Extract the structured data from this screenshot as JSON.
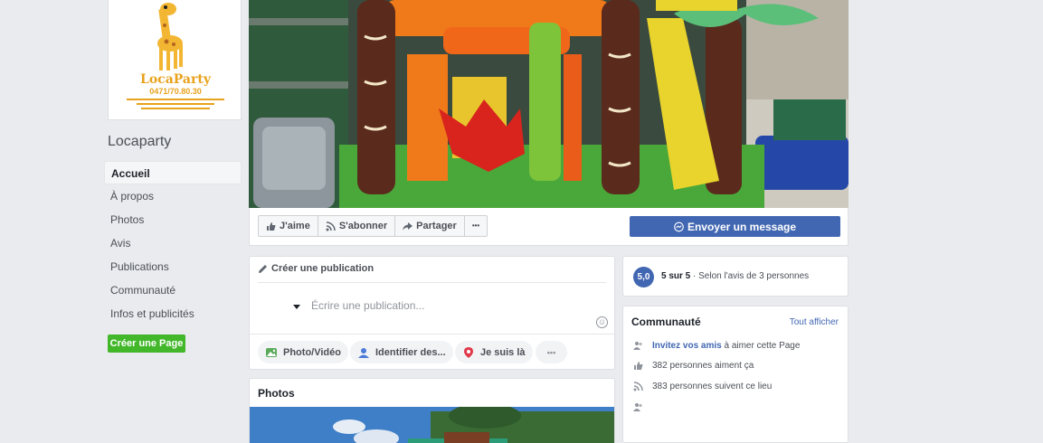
{
  "page": {
    "name": "Locaparty",
    "logo_text": "LocaParty",
    "logo_phone": "0471/70.80.30"
  },
  "nav": {
    "items": [
      {
        "label": "Accueil"
      },
      {
        "label": "À propos"
      },
      {
        "label": "Photos"
      },
      {
        "label": "Avis"
      },
      {
        "label": "Publications"
      },
      {
        "label": "Communauté"
      },
      {
        "label": "Infos et publicités"
      }
    ],
    "create_page": "Créer une Page"
  },
  "actions": {
    "like": "J'aime",
    "follow": "S'abonner",
    "share": "Partager",
    "more": "•••",
    "message": "Envoyer un message"
  },
  "post": {
    "header": "Créer une publication",
    "placeholder": "Écrire une publication...",
    "buttons": [
      {
        "label": "Photo/Vidéo"
      },
      {
        "label": "Identifier des..."
      },
      {
        "label": "Je suis là"
      },
      {
        "label": "•••"
      }
    ]
  },
  "photos": {
    "title": "Photos"
  },
  "rating": {
    "score": "5,0",
    "score_text": "5 sur 5",
    "description": " · Selon l'avis de 3 personnes"
  },
  "community": {
    "title": "Communauté",
    "see_all": "Tout afficher",
    "invite_link": "Invitez vos amis",
    "invite_rest": " à aimer cette Page",
    "likes": "382 personnes aiment ça",
    "follows": "383 personnes suivent ce lieu"
  },
  "colors": {
    "fb_blue": "#4267b2",
    "green": "#42b72a",
    "background": "#e9ebee"
  }
}
